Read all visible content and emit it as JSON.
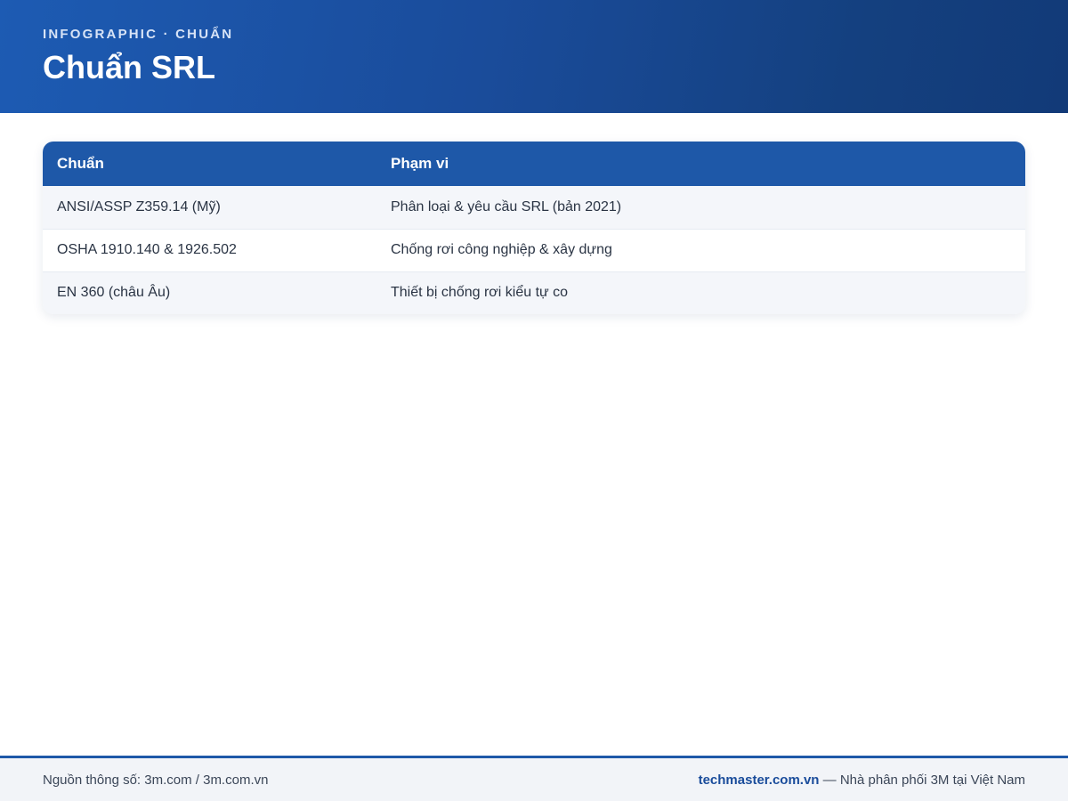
{
  "header": {
    "eyebrow": "INFOGRAPHIC · CHUẨN",
    "title": "Chuẩn SRL"
  },
  "table": {
    "columns": [
      "Chuẩn",
      "Phạm vi"
    ],
    "rows": [
      [
        "ANSI/ASSP Z359.14 (Mỹ)",
        "Phân loại & yêu cầu SRL (bản 2021)"
      ],
      [
        "OSHA 1910.140 & 1926.502",
        "Chống rơi công nghiệp & xây dựng"
      ],
      [
        "EN 360 (châu Âu)",
        "Thiết bị chống rơi kiểu tự co"
      ]
    ]
  },
  "footer": {
    "source": "Nguồn thông số: 3m.com / 3m.com.vn",
    "brand": "techmaster.com.vn",
    "tagline": " — Nhà phân phối 3M tại Việt Nam"
  },
  "colors": {
    "header_bg": "#1a4c9b",
    "table_header_bg": "#1e58a8",
    "row_alt_bg": "#f4f6fa",
    "footer_bg": "#f2f4f8",
    "brand_text": "#1a4c9b"
  }
}
